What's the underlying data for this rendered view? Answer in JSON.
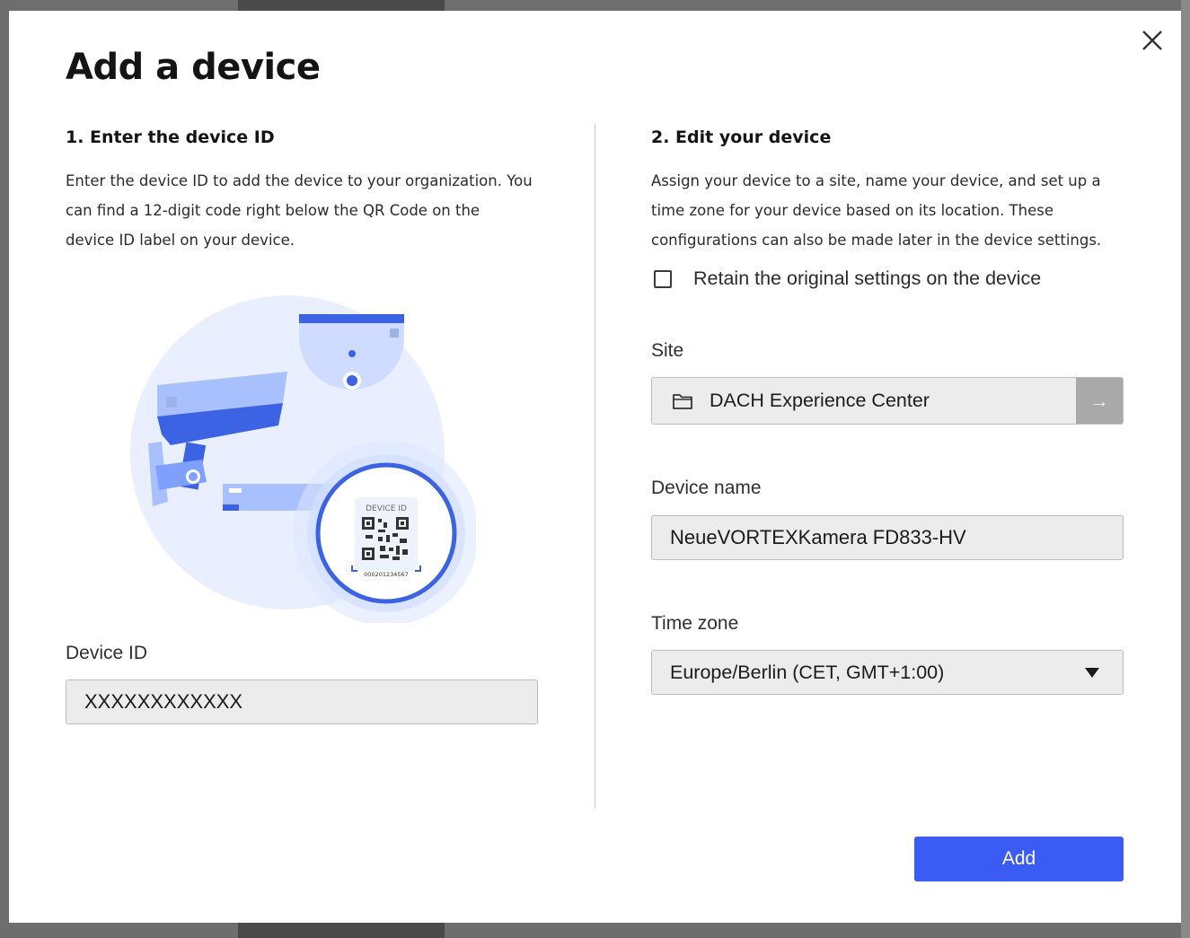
{
  "dialog": {
    "title": "Add a device",
    "close_icon": "close-icon"
  },
  "left": {
    "heading": "1. Enter the device ID",
    "description_lines": [
      "Enter the device ID to add the device to your organization. You",
      "can find a 12-digit code right below the QR Code on the",
      "device ID label on your device."
    ],
    "illustration": {
      "label_title": "DEVICE ID",
      "label_code": "000201234567"
    },
    "device_id_label": "Device ID",
    "device_id_value": "XXXXXXXXXXXX"
  },
  "right": {
    "heading": "2. Edit your device",
    "description_lines": [
      "Assign your device to a site, name your device, and set up a",
      "time zone for your device based on its location. These",
      "configurations can also be made later in the device settings."
    ],
    "retain_checkbox": {
      "label": "Retain the original settings on the device",
      "checked": false
    },
    "site_label": "Site",
    "site_value": "DACH Experience Center",
    "site_folder_icon": "folder-icon",
    "site_arrow_icon": "arrow-right-icon",
    "device_name_label": "Device name",
    "device_name_value": "NeueVORTEXKamera FD833-HV",
    "time_zone_label": "Time zone",
    "time_zone_value": "Europe/Berlin (CET, GMT+1:00)"
  },
  "footer": {
    "add_label": "Add"
  },
  "colors": {
    "primary": "#3a5cf5",
    "input_bg": "#ececec",
    "illustration_light": "#e8efff",
    "illustration_blue": "#4a6ff0"
  }
}
